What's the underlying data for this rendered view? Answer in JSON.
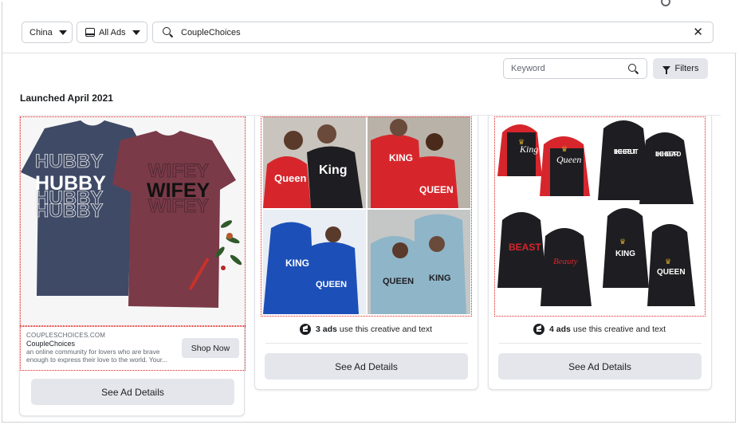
{
  "filters": {
    "country": "China",
    "ad_type": "All Ads",
    "search_query": "CoupleChoices",
    "keyword_placeholder": "Keyword",
    "filters_label": "Filters"
  },
  "section": {
    "title": "Launched April 2021"
  },
  "cards": [
    {
      "domain": "COUPLESCHOICES.COM",
      "page_name": "CoupleChoices",
      "description": "an online community for lovers who are brave enough to express their love to the world. Your...",
      "cta": "Shop Now",
      "details_label": "See Ad Details",
      "image_text": {
        "left": "HUBBY",
        "right": "WIFEY"
      }
    },
    {
      "uses_count": "3 ads",
      "uses_text": "use this creative and text",
      "details_label": "See Ad Details",
      "tile_texts": [
        "Queen",
        "King",
        "KING",
        "QUEEN",
        "KING",
        "QUEEN",
        "QUEEN",
        "KING"
      ]
    },
    {
      "uses_count": "4 ads",
      "uses_text": "use this creative and text",
      "details_label": "See Ad Details",
      "tile_texts": [
        "King",
        "Queen",
        "I LIKE HER BUTT",
        "I LIKE HIS BEARD",
        "BEAST",
        "Beauty",
        "KING",
        "QUEEN"
      ]
    }
  ],
  "colors": {
    "hoodie_red": "#d6262c",
    "hoodie_black": "#1e1e22",
    "hoodie_blue": "#1d4fb8",
    "hoodie_lightblue": "#8fb5c8",
    "shirt_navy": "#3f4a66",
    "shirt_maroon": "#7a3a48",
    "button_gray": "#e4e6eb",
    "selection_red": "#e02020"
  }
}
